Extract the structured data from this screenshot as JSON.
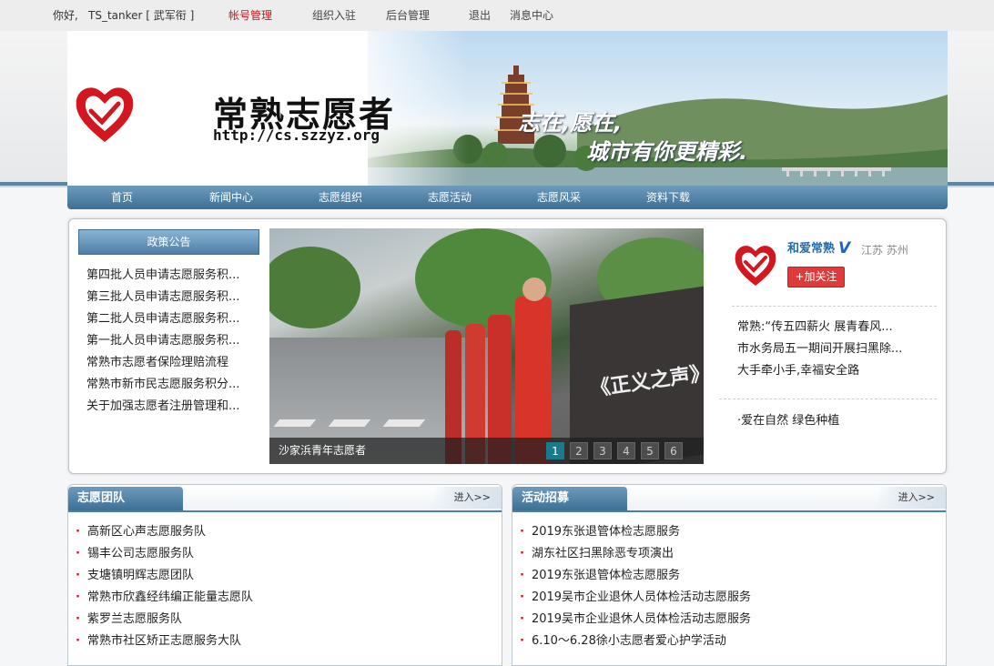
{
  "topbar": {
    "greeting": "你好,",
    "user": "TS_tanker [ 武军衔 ]",
    "account": "帐号管理",
    "org_join": "组织入驻",
    "admin": "后台管理",
    "logout": "退出",
    "messages": "消息中心"
  },
  "header": {
    "logo_title": "常熟志愿者",
    "logo_url": "http://cs.szzyz.org",
    "slogan_line1": "志在,愿在,",
    "slogan_line2": "城市有你更精彩."
  },
  "nav": {
    "items": [
      "首页",
      "新闻中心",
      "志愿组织",
      "志愿活动",
      "志愿风采",
      "资料下载"
    ]
  },
  "policy": {
    "title": "政策公告",
    "items": [
      "第四批人员申请志愿服务积...",
      "第三批人员申请志愿服务积...",
      "第二批人员申请志愿服务积...",
      "第一批人员申请志愿服务积...",
      "常熟市志愿者保险理赔流程",
      "常熟市新市民志愿服务积分...",
      "关于加强志愿者注册管理和..."
    ]
  },
  "slideshow": {
    "caption": "沙家浜青年志愿者",
    "board_text": "《正义之声》",
    "pages": [
      "1",
      "2",
      "3",
      "4",
      "5",
      "6"
    ],
    "active_page": "1"
  },
  "weibo": {
    "name": "和爱常熟",
    "verified": "V",
    "location": "江苏 苏州",
    "follow": "+加关注",
    "posts": [
      "常熟:“传五四薪火 展青春风...",
      "市水务局五一期间开展扫黑除...",
      "大手牵小手,幸福安全路"
    ],
    "tag": "·爱在自然 绿色种植"
  },
  "teams": {
    "title": "志愿团队",
    "more": "进入>>",
    "items": [
      "高新区心声志愿服务队",
      "锡丰公司志愿服务队",
      "支塘镇明辉志愿团队",
      "常熟市欣鑫经纬编正能量志愿队",
      "紫罗兰志愿服务队",
      "常熟市社区矫正志愿服务大队"
    ]
  },
  "recruit": {
    "title": "活动招募",
    "more": "进入>>",
    "items": [
      "2019东张退管体检志愿服务",
      "湖东社区扫黑除恶专项演出",
      "2019东张退管体检志愿服务",
      "2019吴市企业退休人员体检活动志愿服务",
      "2019吴市企业退休人员体检活动志愿服务",
      "6.10～6.28徐小志愿者爱心护学活动"
    ]
  },
  "colors": {
    "accent_red": "#c6161e",
    "nav_blue": "#4e7fa6",
    "active_dot": "#1a7a8a"
  }
}
